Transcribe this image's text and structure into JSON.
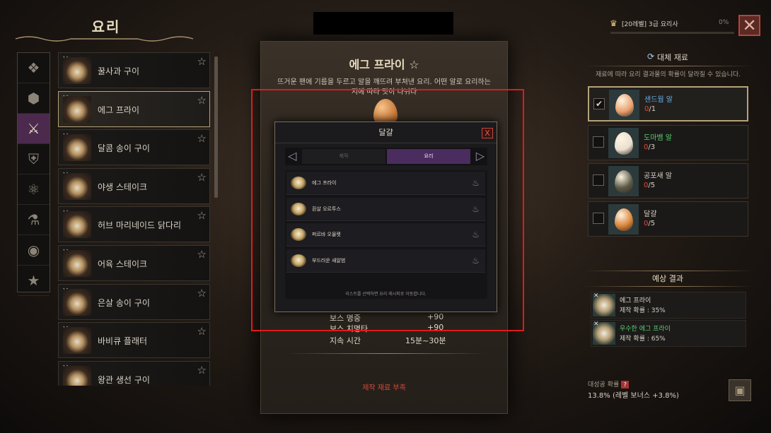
{
  "window": {
    "title": "요리"
  },
  "categories": [
    {
      "icon": "diamond-grid-icon"
    },
    {
      "icon": "cube-icon"
    },
    {
      "icon": "crossed-swords-icon",
      "active": true
    },
    {
      "icon": "armor-icon"
    },
    {
      "icon": "atom-icon"
    },
    {
      "icon": "flask-icon"
    },
    {
      "icon": "coins-icon"
    },
    {
      "icon": "star-icon"
    }
  ],
  "recipes": [
    {
      "name": "꿀사과 구이"
    },
    {
      "name": "에그 프라이",
      "selected": true
    },
    {
      "name": "달콤 송이 구이"
    },
    {
      "name": "야생 스테이크"
    },
    {
      "name": "허브 마리네이드 닭다리"
    },
    {
      "name": "어육 스테이크"
    },
    {
      "name": "은살 송이 구이"
    },
    {
      "name": "바비큐 플래터"
    },
    {
      "name": "왕관 생선 구이"
    }
  ],
  "detail": {
    "title": "에그 프라이 ☆",
    "desc1": "뜨거운 팬에 기름을 두르고 알을 깨뜨려 부쳐낸 요리. 어떤 알로 요리하는",
    "desc2": "지에 따라 맛이 나뉘다",
    "stats": [
      {
        "label": "보스 명중",
        "value": "+90"
      },
      {
        "label": "보스 치명타",
        "value": "+90"
      },
      {
        "label": "지속 시간",
        "value": "15분~30분"
      }
    ],
    "fail": "제작 재료 부족"
  },
  "dialog": {
    "title": "달걀",
    "close": "X",
    "tab_craft": "제작",
    "tab_cook": "요리",
    "items": [
      {
        "name": "에그 프라이"
      },
      {
        "name": "흰살 오르투스"
      },
      {
        "name": "퍼르바 오믈렛"
      },
      {
        "name": "부드러운 새알범"
      }
    ],
    "hint": "리스트를 선택하면 요리 레시피로 이동합니다."
  },
  "level": {
    "label": "[20레벨] 3급 요리사",
    "percent": "0%",
    "progress": 0
  },
  "alt": {
    "title": "대체 재료",
    "desc": "재료에 따라 요리 결과물의 확률이 달라질 수 있습니다.",
    "materials": [
      {
        "name": "샌드웜 알",
        "owned": "0",
        "need": "/1",
        "color": "#6ab0e8",
        "checked": true,
        "egg": "#e8a070"
      },
      {
        "name": "도마뱀 알",
        "owned": "0",
        "need": "/3",
        "color": "#5ccc70",
        "checked": false,
        "egg": "#e8e0d0"
      },
      {
        "name": "공포새 알",
        "owned": "0",
        "need": "/5",
        "color": "#d8d0c4",
        "checked": false,
        "egg": "#5a5a48"
      },
      {
        "name": "달걀",
        "owned": "0",
        "need": "/5",
        "color": "#d8d0c4",
        "checked": false,
        "egg": "#d8843a"
      }
    ]
  },
  "expected": {
    "title": "예상 결과",
    "results": [
      {
        "name": "에그 프라이",
        "prob": "제작 확률 : 35%",
        "color": "#e0d8c8"
      },
      {
        "name": "우수한 에그 프라이",
        "prob": "제작 확률 : 65%",
        "color": "#5ccc70"
      }
    ]
  },
  "great": {
    "label": "대성공 확률",
    "help": "?",
    "value": "13.8% (레벨 보너스 +3.8%)"
  },
  "colors": {
    "accent": "#b5a27a",
    "danger": "#e01a1a",
    "active_tab": "#4a2c5e"
  }
}
